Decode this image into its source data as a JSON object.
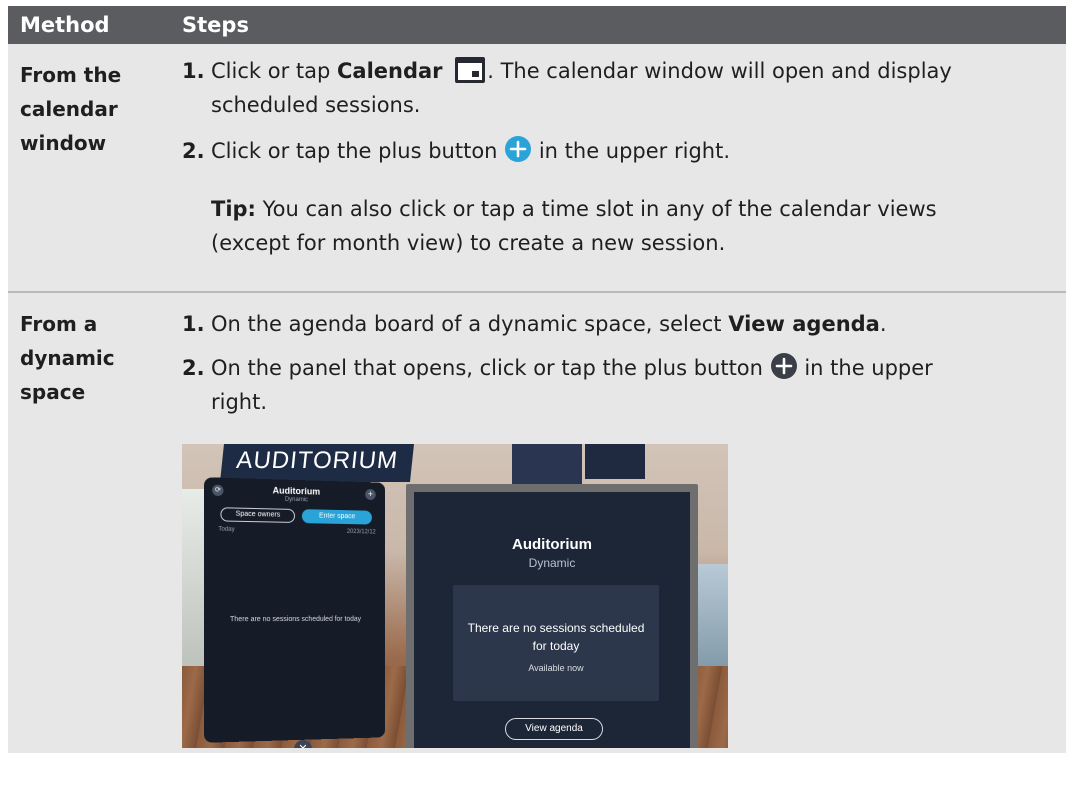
{
  "table": {
    "headers": {
      "method": "Method",
      "steps": "Steps"
    },
    "rows": [
      {
        "method": [
          "From the",
          "calendar",
          "window"
        ],
        "steps": [
          {
            "num": "1.",
            "pre": "Click or tap ",
            "bold": "Calendar",
            "post": ". The calendar window will open and display",
            "line2": "scheduled sessions."
          },
          {
            "num": "2.",
            "pre": "Click or tap the plus button ",
            "post": " in the upper right."
          }
        ],
        "tip": {
          "label": "Tip:",
          "text": " You can also click or tap a time slot in any of the calendar views",
          "line2": "(except for month view) to create a new session."
        }
      },
      {
        "method": [
          "From a",
          "dynamic",
          "space"
        ],
        "steps": [
          {
            "num": "1.",
            "pre": "On the agenda board of a dynamic space, select ",
            "bold": "View agenda",
            "post": "."
          },
          {
            "num": "2.",
            "pre": "On the panel that opens, click or tap the plus button ",
            "post": " in the upper",
            "line2": "right."
          }
        ]
      }
    ]
  },
  "screenshot": {
    "banner": "AUDITORIUM",
    "left_panel": {
      "title": "Auditorium",
      "subtitle": "Dynamic",
      "space_owners": "Space owners",
      "enter_space": "Enter space",
      "today": "Today",
      "date": "2023/12/12",
      "empty": "There are no sessions scheduled for today"
    },
    "right_panel": {
      "title": "Auditorium",
      "subtitle": "Dynamic",
      "empty_line1": "There are no sessions scheduled",
      "empty_line2": "for today",
      "available": "Available now",
      "view_agenda": "View agenda"
    }
  },
  "colors": {
    "header_bg": "#5a5c60",
    "row_bg": "#e7e7e8",
    "plus_blue": "#2aa3d8",
    "plus_dark": "#3a3f47"
  },
  "icons": [
    "calendar-icon",
    "plus-circle-icon",
    "plus-circle-dark-icon",
    "refresh-icon",
    "close-icon"
  ]
}
